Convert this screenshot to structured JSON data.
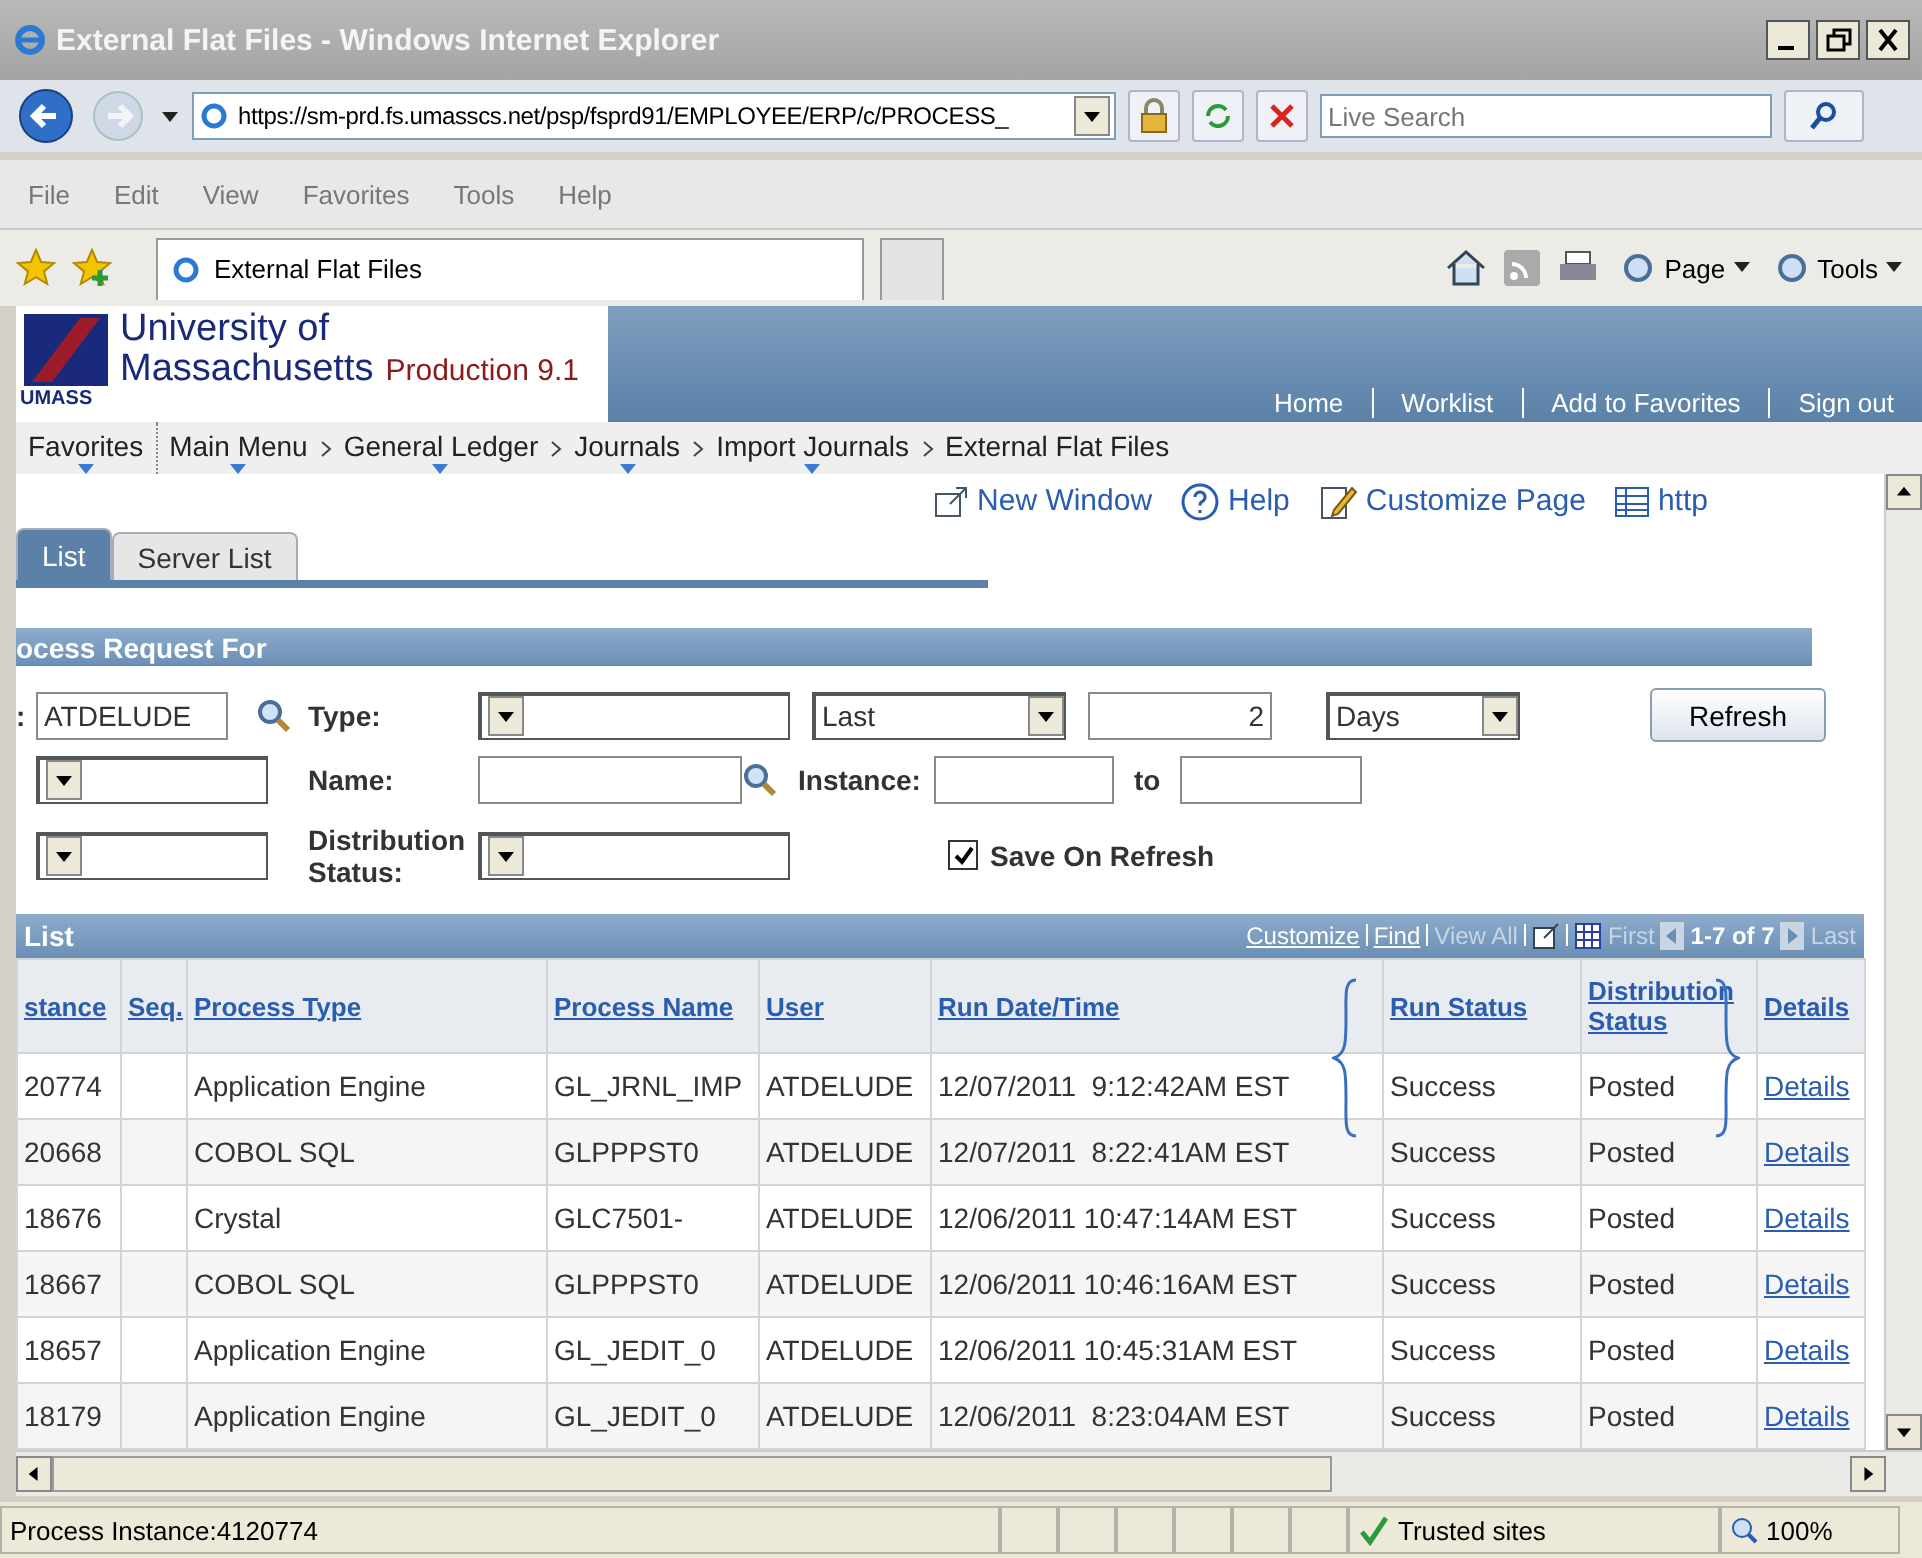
{
  "window": {
    "title": "External Flat Files - Windows Internet Explorer"
  },
  "address_bar": {
    "url": "https://sm-prd.fs.umasscs.net/psp/fsprd91/EMPLOYEE/ERP/c/PROCESS_",
    "search_placeholder": "Live Search"
  },
  "menu": [
    "File",
    "Edit",
    "View",
    "Favorites",
    "Tools",
    "Help"
  ],
  "browser_tabs": [
    {
      "label": "External Flat Files",
      "selected": true
    }
  ],
  "command_bar": [
    "Page",
    "Tools"
  ],
  "header": {
    "logo_lines": [
      "University of",
      "Massachusetts"
    ],
    "environment": "Production 9.1",
    "logo_mark": "UMASS",
    "links": [
      "Home",
      "Worklist",
      "Add to Favorites",
      "Sign out"
    ]
  },
  "breadcrumb": [
    {
      "label": "Favorites",
      "has_menu": true
    },
    {
      "label": "Main Menu",
      "has_menu": true
    },
    {
      "label": "General Ledger",
      "has_menu": true
    },
    {
      "label": "Journals",
      "has_menu": true
    },
    {
      "label": "Import Journals",
      "has_menu": true
    },
    {
      "label": "External Flat Files",
      "has_menu": false
    }
  ],
  "page_links": [
    {
      "label": "New Window",
      "kind": "window"
    },
    {
      "label": "Help",
      "kind": "help"
    },
    {
      "label": "Customize Page",
      "kind": "customize"
    },
    {
      "label": "http",
      "kind": "http"
    }
  ],
  "page_tabs": [
    {
      "label": "List",
      "selected": true
    },
    {
      "label": "Server List",
      "selected": false
    }
  ],
  "request_panel": {
    "title": "ocess Request For",
    "user_label": ":",
    "user_id": "ATDELUDE",
    "type_label": "Type:",
    "name_label": "Name:",
    "instance_label": "Instance:",
    "to_label": "to",
    "distribution_label": "Distribution Status:",
    "last_value": "Last",
    "count_value": "2",
    "unit_value": "Days",
    "save_on_refresh": {
      "label": "Save On Refresh",
      "checked": true
    },
    "refresh_button": "Refresh"
  },
  "grid": {
    "title": "List",
    "tools": [
      {
        "label": "Customize",
        "disabled": false
      },
      {
        "label": "Find",
        "disabled": false
      },
      {
        "label": "View All",
        "disabled": true
      }
    ],
    "pager": {
      "first": {
        "label": "First",
        "disabled": true
      },
      "range": "1-7 of 7",
      "last": {
        "label": "Last",
        "disabled": true
      }
    },
    "columns": [
      "stance",
      "Seq.",
      "Process Type",
      "Process Name",
      "User",
      "Run Date/Time",
      "Run Status",
      "Distribution Status",
      "Details"
    ],
    "rows": [
      {
        "instance": "20774",
        "process_type": "Application Engine",
        "process_name": "GL_JRNL_IMP",
        "user": "ATDELUDE",
        "run_date": "12/07/2011  9:12:42AM EST",
        "run_status": "Success",
        "distribution_status": "Posted",
        "details": "Details"
      },
      {
        "instance": "20668",
        "process_type": "COBOL SQL",
        "process_name": "GLPPPST0",
        "user": "ATDELUDE",
        "run_date": "12/07/2011  8:22:41AM EST",
        "run_status": "Success",
        "distribution_status": "Posted",
        "details": "Details"
      },
      {
        "instance": "18676",
        "process_type": "Crystal",
        "process_name": "GLC7501-",
        "user": "ATDELUDE",
        "run_date": "12/06/2011 10:47:14AM EST",
        "run_status": "Success",
        "distribution_status": "Posted",
        "details": "Details"
      },
      {
        "instance": "18667",
        "process_type": "COBOL SQL",
        "process_name": "GLPPPST0",
        "user": "ATDELUDE",
        "run_date": "12/06/2011 10:46:16AM EST",
        "run_status": "Success",
        "distribution_status": "Posted",
        "details": "Details"
      },
      {
        "instance": "18657",
        "process_type": "Application Engine",
        "process_name": "GL_JEDIT_0",
        "user": "ATDELUDE",
        "run_date": "12/06/2011 10:45:31AM EST",
        "run_status": "Success",
        "distribution_status": "Posted",
        "details": "Details"
      },
      {
        "instance": "18179",
        "process_type": "Application Engine",
        "process_name": "GL_JEDIT_0",
        "user": "ATDELUDE",
        "run_date": "12/06/2011  8:23:04AM EST",
        "run_status": "Success",
        "distribution_status": "Posted",
        "details": "Details"
      }
    ]
  },
  "status_bar": {
    "text": "Process Instance:4120774",
    "zone": "Trusted sites",
    "zoom": "100%"
  }
}
